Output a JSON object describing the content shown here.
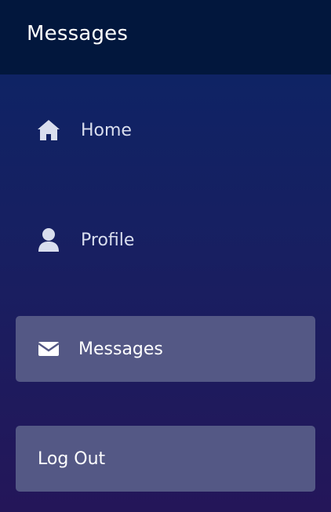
{
  "header": {
    "title": "Messages"
  },
  "nav": {
    "items": [
      {
        "label": "Home",
        "icon": "home-icon"
      },
      {
        "label": "Profile",
        "icon": "user-icon"
      },
      {
        "label": "Messages",
        "icon": "envelope-icon",
        "active": true
      },
      {
        "label": "Log Out"
      }
    ]
  },
  "colors": {
    "header_bg": "#02173d",
    "gradient_top": "#0b2566",
    "gradient_bottom": "#241659",
    "active_item_bg": "#545885",
    "icon_color": "#d9deee"
  }
}
